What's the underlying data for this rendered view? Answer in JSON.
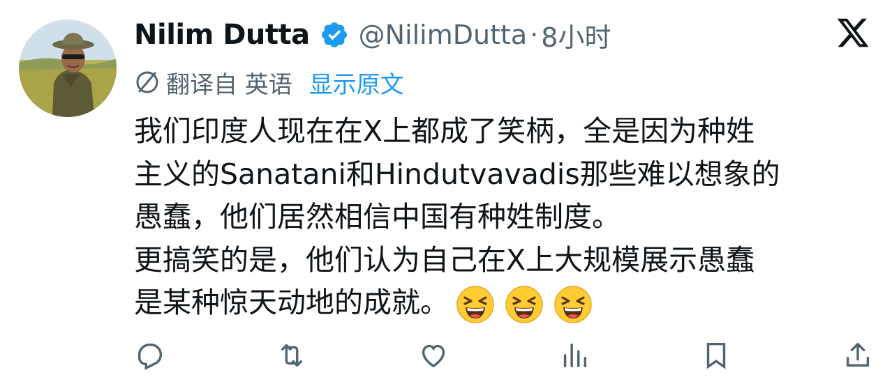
{
  "tweet": {
    "display_name": "Nilim Dutta",
    "handle": "@NilimDutta",
    "separator": "·",
    "time": "8小时",
    "translated_label": "翻译自 英语",
    "show_original": "显示原文",
    "text_lines": [
      "我们印度人现在在X上都成了笑柄，全是因为种姓",
      "主义的Sanatani和Hindutvavadis那些难以想象的",
      "愚蠢，他们居然相信中国有种姓制度。",
      "更搞笑的是，他们认为自己在X上大规模展示愚蠢",
      "是某种惊天动地的成就。"
    ],
    "emojis": [
      "grinning-squinting-face-emoji",
      "grinning-squinting-face-emoji",
      "grinning-squinting-face-emoji"
    ]
  },
  "icons": {
    "verified": "verified-badge-icon",
    "brand": "x-logo-icon",
    "translate": "translate-globe-icon",
    "reply": "reply-icon",
    "retweet": "retweet-icon",
    "like": "heart-icon",
    "views": "views-icon",
    "bookmark": "bookmark-icon",
    "share": "share-icon"
  },
  "colors": {
    "verified": "#1d9bf0",
    "link": "#1d9bf0",
    "secondary_text": "#536471",
    "primary_text": "#0f1419"
  }
}
